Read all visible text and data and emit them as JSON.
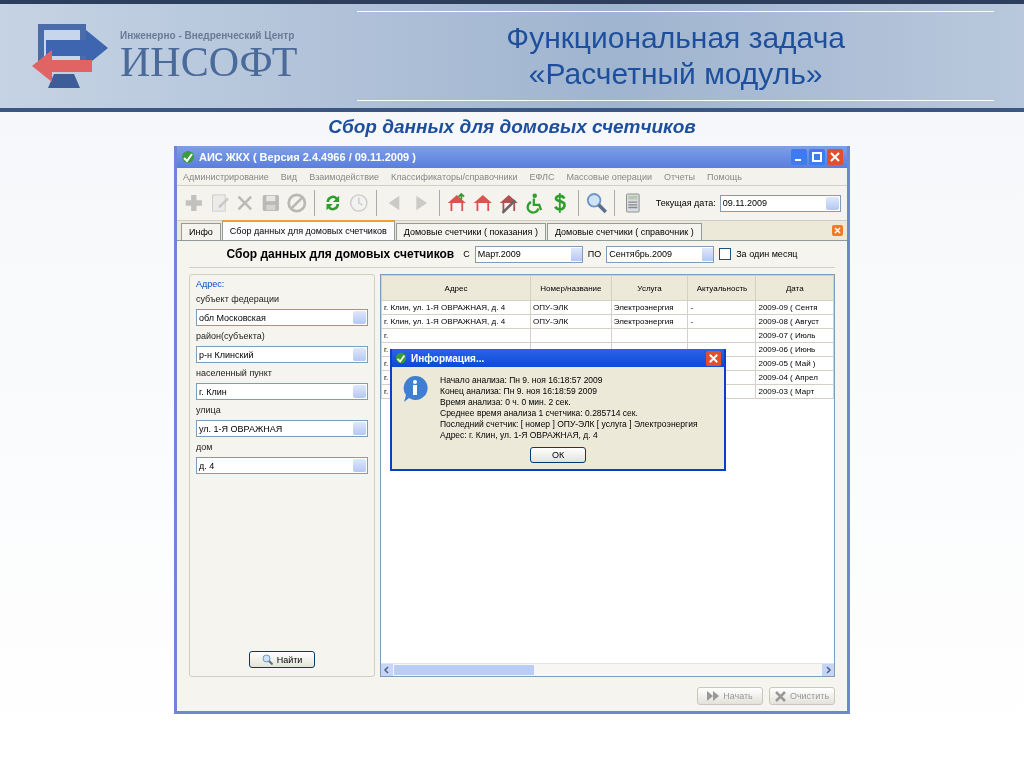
{
  "slide": {
    "company_caption": "Инженерно - Внедренческий Центр",
    "company_name": "ИНСОФТ",
    "title_lines": [
      "Функциональная задача",
      "«Расчетный модуль»"
    ],
    "subtitle": "Сбор данных для домовых счетчиков"
  },
  "window": {
    "title": "АИС ЖКХ ( Версия 2.4.4966 / 09.11.2009 )"
  },
  "menu": [
    "Администрирование",
    "Вид",
    "Взаимодействие",
    "Классификаторы/справочники",
    "ЕФЛС",
    "Массовые операции",
    "Отчеты",
    "Помощь"
  ],
  "toolbar": [
    [
      {
        "kind": "add",
        "disabled": true
      },
      {
        "kind": "edit",
        "disabled": true
      },
      {
        "kind": "delete",
        "disabled": true
      },
      {
        "kind": "save",
        "disabled": true
      },
      {
        "kind": "cancel",
        "disabled": true
      }
    ],
    [
      {
        "kind": "refresh",
        "disabled": false
      },
      {
        "kind": "clock",
        "disabled": true
      }
    ],
    [
      {
        "kind": "back",
        "disabled": true
      },
      {
        "kind": "forward",
        "disabled": true
      }
    ],
    [
      {
        "kind": "house-up",
        "disabled": false
      },
      {
        "kind": "house",
        "disabled": false
      },
      {
        "kind": "house-edit",
        "disabled": false
      },
      {
        "kind": "wheelchair",
        "disabled": false
      },
      {
        "kind": "dollar",
        "disabled": false
      }
    ],
    [
      {
        "kind": "search",
        "disabled": false
      }
    ],
    [
      {
        "kind": "calculator",
        "disabled": false
      }
    ]
  ],
  "current_date": {
    "label": "Текущая дата:",
    "value": "09.11.2009"
  },
  "tabs": [
    {
      "label": "Инфо",
      "selected": false
    },
    {
      "label": "Сбор данных для домовых счетчиков",
      "selected": true
    },
    {
      "label": "Домовые счетчики ( показания )",
      "selected": false
    },
    {
      "label": "Домовые счетчики ( справочник )",
      "selected": false
    }
  ],
  "form": {
    "heading": "Сбор данных для домовых счетчиков",
    "from_label": "С",
    "from_value": "Март.2009",
    "to_label": "ПО",
    "to_value": "Сентябрь.2009",
    "one_month": {
      "label": "За один месяц",
      "checked": false
    }
  },
  "address": {
    "legend": "Адрес:",
    "fields": [
      {
        "label": "субъект федерации",
        "value": "обл Московская"
      },
      {
        "label": "район(субъекта)",
        "value": "р-н Клинский"
      },
      {
        "label": "населенный пункт",
        "value": "г. Клин"
      },
      {
        "label": "улица",
        "value": "ул. 1-Я ОВРАЖНАЯ"
      },
      {
        "label": "дом",
        "value": "д. 4"
      }
    ],
    "find_button": "Найти"
  },
  "table": {
    "columns": [
      "Адрес",
      "Номер/название",
      "Услуга",
      "Актуальность",
      "Дата"
    ],
    "rows": [
      [
        "г. Клин, ул. 1-Я ОВРАЖНАЯ, д. 4",
        "ОПУ-ЭЛК",
        "Электроэнергия",
        "-",
        "2009-09 ( Сентя"
      ],
      [
        "г. Клин, ул. 1-Я ОВРАЖНАЯ, д. 4",
        "ОПУ-ЭЛК",
        "Электроэнергия",
        "-",
        "2009-08 ( Август"
      ],
      [
        "г.",
        null,
        null,
        null,
        "2009-07 ( Июль"
      ],
      [
        "г.",
        null,
        null,
        null,
        "2009-06 ( Июнь"
      ],
      [
        "г.",
        null,
        null,
        null,
        "2009-05 ( Май )"
      ],
      [
        "г.",
        null,
        null,
        null,
        "2009-04 ( Апрел"
      ],
      [
        "г.",
        null,
        null,
        null,
        "2009-03 ( Март"
      ]
    ]
  },
  "dialog": {
    "title": "Информация...",
    "lines": [
      "Начало анализа: Пн 9. ноя 16:18:57 2009",
      "Конец анализа:  Пн 9. ноя 16:18:59 2009",
      "Время анализа: 0 ч. 0 мин. 2 сек.",
      "Среднее время анализа 1 счетчика: 0.285714 сек.",
      "Последний счетчик: [ номер ] ОПУ-ЭЛК [ услуга ] Электроэнергия",
      "Адрес: г. Клин, ул. 1-Я ОВРАЖНАЯ, д. 4"
    ],
    "ok": "ОК"
  },
  "bottom_buttons": [
    {
      "label": "Начать",
      "kind": "start",
      "disabled": true
    },
    {
      "label": "Очистить",
      "kind": "clear",
      "disabled": true
    }
  ]
}
